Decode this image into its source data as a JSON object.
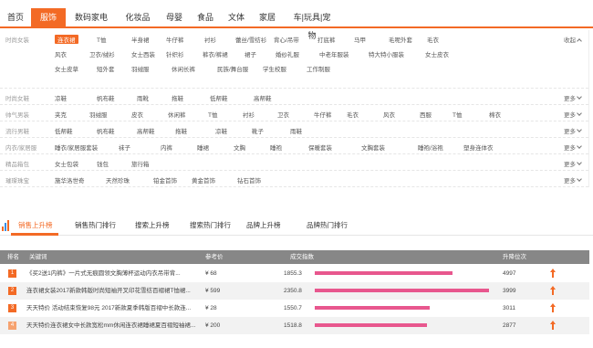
{
  "nav": {
    "items": [
      "首页",
      "服饰",
      "数码家电",
      "化妆品",
      "母婴",
      "食品",
      "文体",
      "家居",
      "车|玩具|宠物"
    ],
    "active_index": 1
  },
  "filters": [
    {
      "label": "时尚女装",
      "items": [
        "连衣裙",
        "T恤",
        "半身裙",
        "牛仔裤",
        "衬衫",
        "蕾丝/雪纺衫",
        "背心/吊带",
        "打底裤",
        "马甲",
        "毛呢外套",
        "毛衣",
        "风衣",
        "卫衣/绒衫",
        "女士西装",
        "针织衫",
        "裤衣/裤裙",
        "裙子",
        "婚纱礼服",
        "中老年服装",
        "特大特小服装",
        "女士皮衣",
        "女士皮草",
        "短外套",
        "羽绒服",
        "休闲长裤",
        "民族/舞台服",
        "学生校服",
        "工作制服"
      ],
      "active": "连衣裙",
      "more": "收起"
    },
    {
      "label": "时尚女鞋",
      "items": [
        "凉鞋",
        "帆布鞋",
        "雨靴",
        "拖鞋",
        "低帮鞋",
        "高帮鞋"
      ],
      "more": "更多"
    },
    {
      "label": "帅气男装",
      "items": [
        "夹克",
        "羽绒服",
        "皮衣",
        "休闲裤",
        "T恤",
        "衬衫",
        "卫衣",
        "牛仔裤",
        "毛衣",
        "风衣",
        "西服",
        "T恤",
        "棉衣"
      ],
      "more": "更多"
    },
    {
      "label": "流行男鞋",
      "items": [
        "低帮鞋",
        "帆布鞋",
        "高帮鞋",
        "拖鞋",
        "凉鞋",
        "靴子",
        "雨鞋"
      ],
      "more": "更多"
    },
    {
      "label": "内衣/家居服",
      "items": [
        "睡衣/家居服套装",
        "袜子",
        "内裤",
        "睡裙",
        "文胸",
        "睡袍",
        "保暖套装",
        "文胸套装",
        "睡袍/浴袍",
        "塑身连体衣"
      ],
      "more": "更多"
    },
    {
      "label": "精品箱包",
      "items": [
        "女士包袋",
        "钱包",
        "旅行箱"
      ],
      "more": "更多"
    },
    {
      "label": "璀璨珠宝",
      "items": [
        "施华洛世奇",
        "天然珍珠",
        "铂金首饰",
        "黄金首饰",
        "钻石首饰"
      ],
      "more": "更多"
    }
  ],
  "tabs": {
    "items": [
      "销售上升榜",
      "销售热门排行",
      "搜索上升榜",
      "搜索热门排行",
      "品牌上升榜",
      "品牌热门排行"
    ],
    "active_index": 0
  },
  "table": {
    "headers": [
      "排名",
      "关键词",
      "参考价",
      "成交指数",
      "升降位次"
    ],
    "rows": [
      {
        "rank": "1",
        "keyword": "《买2送1内裤》一片式无痕圆领文胸薄杯运动内衣吊带背...",
        "price": "¥ 68",
        "index": "1855.3",
        "index_value": 1855.3,
        "change": "4997",
        "trend": "up"
      },
      {
        "rank": "2",
        "keyword": "连衣裙女装2017新款韩版时尚短袖开叉印花雪纺百褶裙T恤裙...",
        "price": "¥ 599",
        "index": "2350.8",
        "index_value": 2350.8,
        "change": "3999",
        "trend": "up"
      },
      {
        "rank": "3",
        "keyword": "天天特价 活动结束恢复98元 2017新款夏季韩版百褶中长款连...",
        "price": "¥ 28",
        "index": "1550.7",
        "index_value": 1550.7,
        "change": "3011",
        "trend": "up"
      },
      {
        "rank": "4",
        "keyword": "天天特价连衣裙女中长款宽松mm休闲连衣裙睡裙夏百褶短袖裙...",
        "price": "¥ 200",
        "index": "1518.8",
        "index_value": 1518.8,
        "change": "2877",
        "trend": "up"
      }
    ]
  },
  "colors": {
    "accent": "#f36a25",
    "index_bar": "#e8578e",
    "header_bg": "#878787",
    "rank_colors": [
      "#f36a25",
      "#f36a25",
      "#f36a25",
      "#f6a26f"
    ]
  }
}
